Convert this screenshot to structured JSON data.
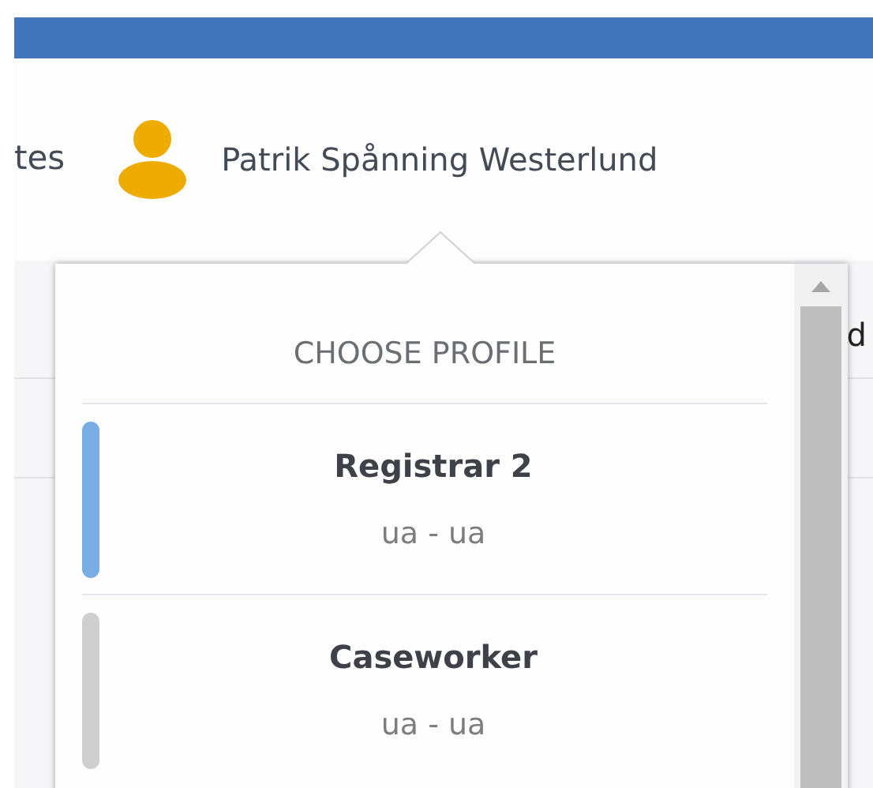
{
  "header": {
    "nav_fragment": "tes",
    "user_name": "Patrik Spånning Westerlund"
  },
  "background": {
    "text_fragment": "d"
  },
  "profile_menu": {
    "title": "CHOOSE PROFILE",
    "profiles": [
      {
        "name": "Registrar 2",
        "detail": "ua - ua",
        "selected": true
      },
      {
        "name": "Caseworker",
        "detail": "ua - ua",
        "selected": false
      }
    ]
  }
}
